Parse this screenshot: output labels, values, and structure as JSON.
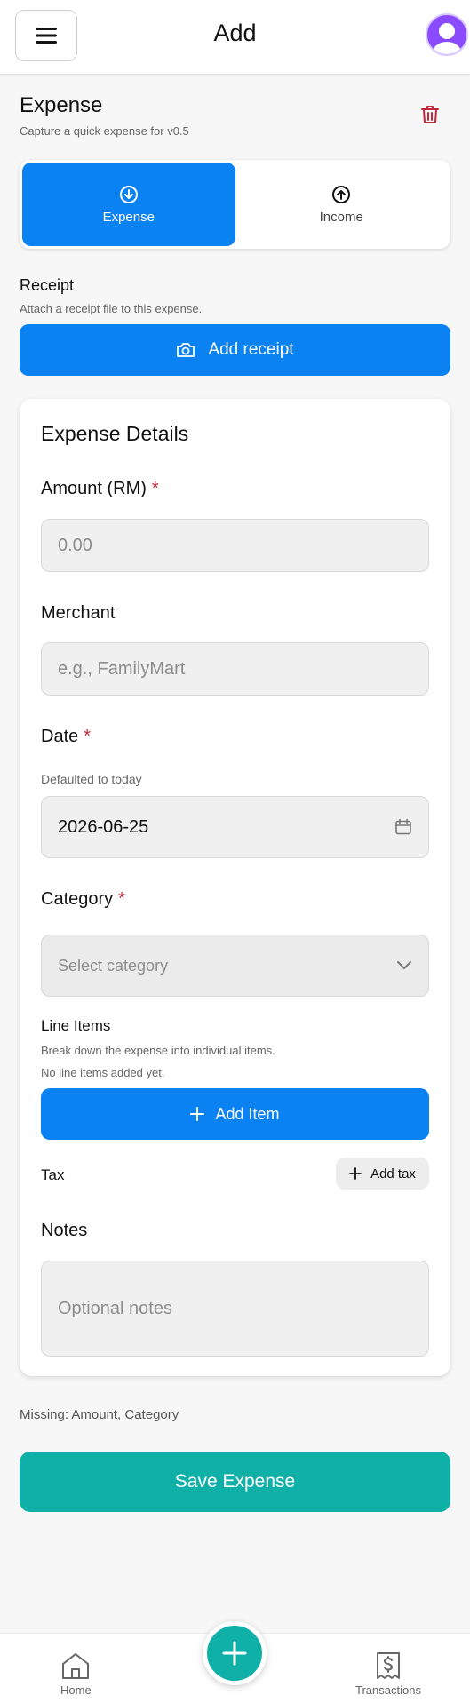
{
  "header": {
    "title": "Add"
  },
  "page": {
    "title": "Expense",
    "subtitle": "Capture a quick expense for v0.5"
  },
  "toggle": {
    "expense_label": "Expense",
    "income_label": "Income",
    "selected": "Expense"
  },
  "receipt": {
    "title": "Receipt",
    "subtitle": "Attach a receipt file to this expense.",
    "button_label": "Add receipt"
  },
  "card": {
    "title": "Expense Details",
    "amount": {
      "label": "Amount (RM)",
      "placeholder": "0.00",
      "required": "*"
    },
    "merchant": {
      "label": "Merchant",
      "placeholder": "e.g., FamilyMart"
    },
    "date": {
      "label": "Date",
      "required": "*",
      "hint": "Defaulted to today",
      "value": "2026-06-25"
    },
    "category": {
      "label": "Category",
      "required": "*",
      "placeholder": "Select category"
    },
    "line_items": {
      "title": "Line Items",
      "subtitle": "Break down the expense into individual items.",
      "empty_text": "No line items added yet.",
      "button_label": "Add Item"
    },
    "tax": {
      "label": "Tax",
      "button_label": "Add tax"
    },
    "notes": {
      "label": "Notes",
      "placeholder": "Optional notes"
    }
  },
  "footer": {
    "missing_text": "Missing: Amount, Category",
    "save_label": "Save Expense"
  },
  "nav": {
    "home_label": "Home",
    "transactions_label": "Transactions"
  },
  "colors": {
    "primary": "#0a82f2",
    "teal": "#0fb0a8",
    "danger": "#c2273a",
    "avatar": "#8a4bff"
  },
  "icons": [
    "menu-icon",
    "avatar-icon",
    "trash-icon",
    "arrow-down-circle-icon",
    "arrow-up-circle-icon",
    "camera-icon",
    "calendar-icon",
    "chevron-down-icon",
    "plus-icon",
    "home-icon",
    "receipt-dollar-icon"
  ]
}
